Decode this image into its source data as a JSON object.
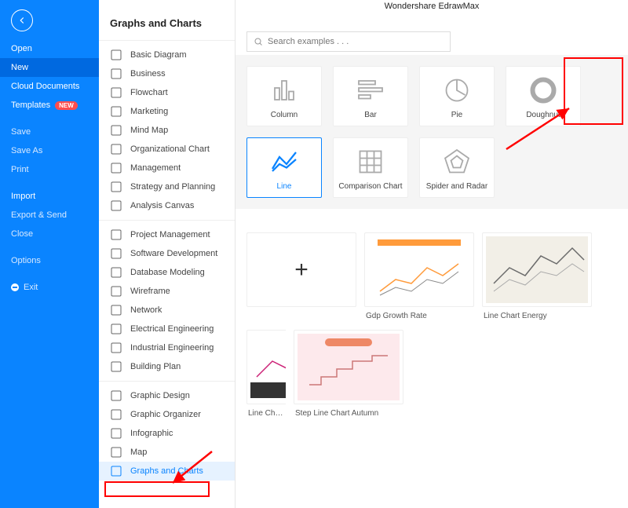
{
  "app_title": "Wondershare EdrawMax",
  "bluerail": {
    "back": "←",
    "items": [
      {
        "label": "Open",
        "k": "open"
      },
      {
        "label": "New",
        "k": "new",
        "selected": true
      },
      {
        "label": "Cloud Documents",
        "k": "cloud"
      },
      {
        "label": "Templates",
        "k": "templates",
        "badge": "NEW"
      },
      {
        "label": "Save",
        "k": "save"
      },
      {
        "label": "Save As",
        "k": "saveas"
      },
      {
        "label": "Print",
        "k": "print"
      },
      {
        "label": "Import",
        "k": "import"
      },
      {
        "label": "Export & Send",
        "k": "export"
      },
      {
        "label": "Close",
        "k": "close"
      },
      {
        "label": "Options",
        "k": "options"
      },
      {
        "label": "Exit",
        "k": "exit",
        "exit_icon": true
      }
    ]
  },
  "catcol": {
    "title": "Graphs and Charts",
    "groups": [
      {
        "items": [
          {
            "label": "Basic Diagram",
            "icon": "grid-icon"
          },
          {
            "label": "Business",
            "icon": "briefcase-icon"
          },
          {
            "label": "Flowchart",
            "icon": "flow-icon"
          },
          {
            "label": "Marketing",
            "icon": "bars-icon"
          },
          {
            "label": "Mind Map",
            "icon": "tree-icon"
          },
          {
            "label": "Organizational Chart",
            "icon": "org-icon"
          },
          {
            "label": "Management",
            "icon": "mgmt-icon"
          },
          {
            "label": "Strategy and Planning",
            "icon": "strategy-icon"
          },
          {
            "label": "Analysis Canvas",
            "icon": "canvas-icon"
          }
        ]
      },
      {
        "items": [
          {
            "label": "Project Management",
            "icon": "gantt-icon"
          },
          {
            "label": "Software Development",
            "icon": "software-icon"
          },
          {
            "label": "Database Modeling",
            "icon": "db-icon"
          },
          {
            "label": "Wireframe",
            "icon": "wire-icon"
          },
          {
            "label": "Network",
            "icon": "network-icon"
          },
          {
            "label": "Electrical Engineering",
            "icon": "ee-icon"
          },
          {
            "label": "Industrial Engineering",
            "icon": "ie-icon"
          },
          {
            "label": "Building Plan",
            "icon": "bp-icon"
          }
        ]
      },
      {
        "items": [
          {
            "label": "Graphic Design",
            "icon": "gd-icon"
          },
          {
            "label": "Graphic Organizer",
            "icon": "go-icon"
          },
          {
            "label": "Infographic",
            "icon": "info-icon"
          },
          {
            "label": "Map",
            "icon": "map-icon"
          },
          {
            "label": "Graphs and Charts",
            "icon": "chart-icon",
            "selected": true
          }
        ]
      }
    ]
  },
  "search": {
    "placeholder": "Search examples . . ."
  },
  "chart_types": [
    {
      "label": "Column",
      "icon": "column"
    },
    {
      "label": "Bar",
      "icon": "bar"
    },
    {
      "label": "Pie",
      "icon": "pie"
    },
    {
      "label": "Doughnut",
      "icon": "doughnut"
    },
    {
      "label": "Line",
      "icon": "line",
      "selected": true
    },
    {
      "label": "Comparison Chart",
      "icon": "table"
    },
    {
      "label": "Spider and Radar",
      "icon": "radar"
    }
  ],
  "templates": [
    {
      "label": "",
      "kind": "new"
    },
    {
      "label": "Gdp Growth Rate",
      "kind": "lineA"
    },
    {
      "label": "Line Chart Energy",
      "kind": "lineB"
    },
    {
      "label": "Line Chart Pa",
      "kind": "lineC",
      "partial": true
    },
    {
      "label": "Step Line Chart Autumn",
      "kind": "step"
    }
  ]
}
